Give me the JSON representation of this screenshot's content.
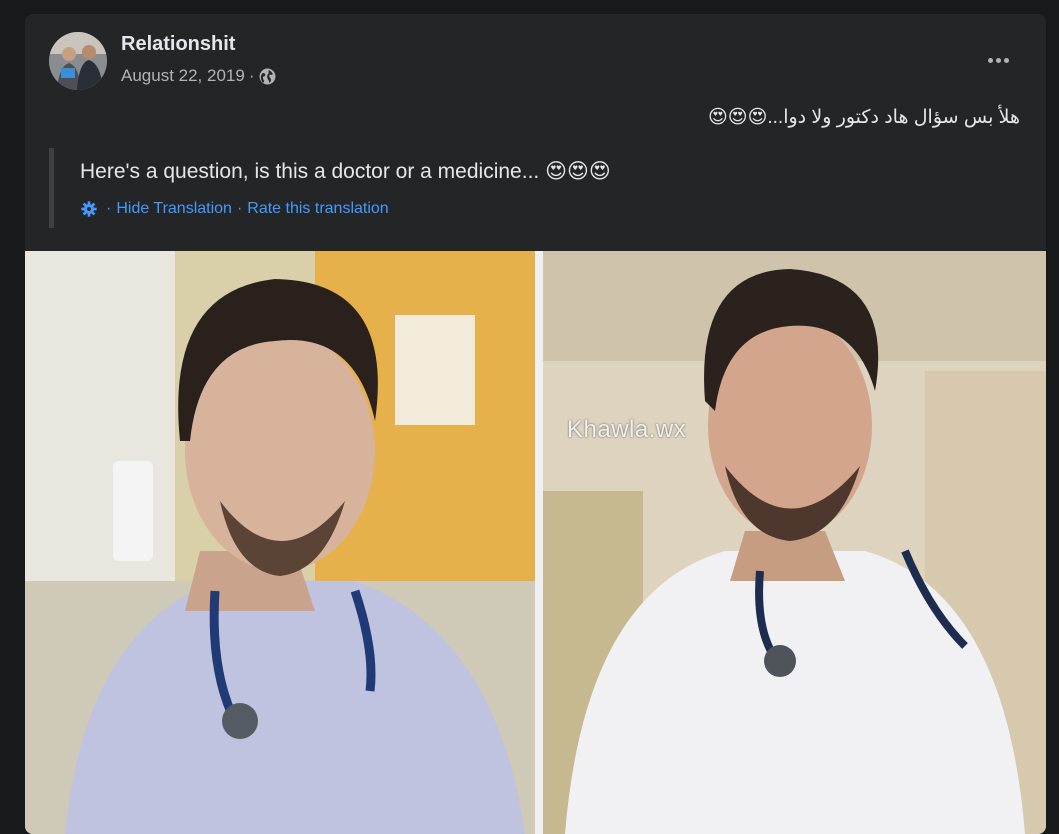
{
  "post": {
    "page_name": "Relationshit",
    "date": "August 22, 2019",
    "separator": "·",
    "privacy_icon": "globe-icon",
    "more_icon": "more-options-icon",
    "original_text": "هلأ بس سؤال هاد دكتور ولا دوا...😍😍😍",
    "translation": {
      "text": "Here's a question, is this a doctor or a medicine... 😍😍😍",
      "settings_icon": "gear-icon",
      "hide_label": "Hide Translation",
      "rate_label": "Rate this translation"
    },
    "image": {
      "watermark": "Khawla.wx"
    }
  }
}
